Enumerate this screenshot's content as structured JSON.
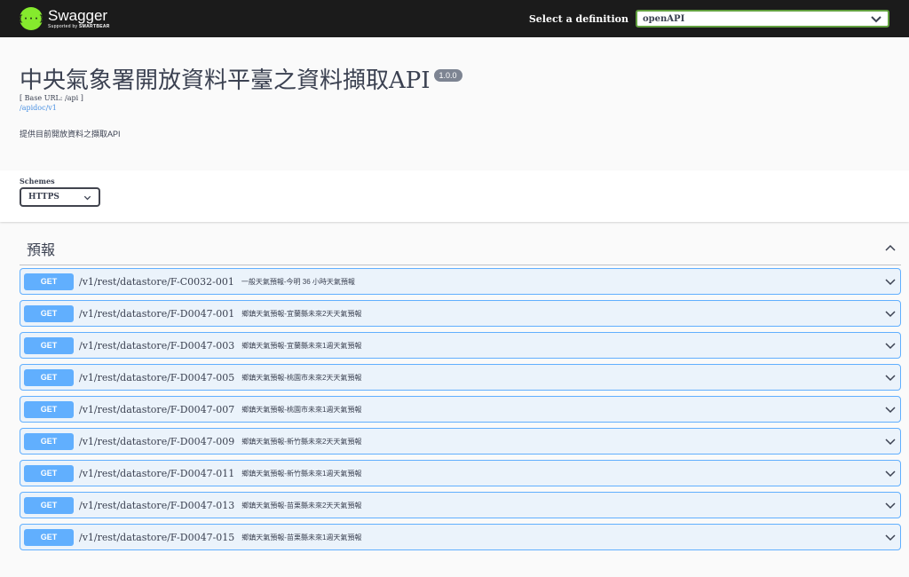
{
  "topbar": {
    "logo_mark": "{···}",
    "logo_name": "Swagger",
    "logo_sub_prefix": "Supported by ",
    "logo_sub_brand": "SMARTBEAR",
    "definition_label": "Select a definition",
    "definition_value": "openAPI"
  },
  "info": {
    "title": "中央氣象署開放資料平臺之資料擷取API",
    "version": "1.0.0",
    "base_url": "[ Base URL: /api ]",
    "link": "/apidoc/v1",
    "description": "提供目前開放資料之擷取API"
  },
  "schemes": {
    "label": "Schemes",
    "value": "HTTPS"
  },
  "section": {
    "tag": "預報",
    "operations": [
      {
        "method": "GET",
        "path": "/v1/rest/datastore/F-C0032-001",
        "summary": "一般天氣預報-今明 36 小時天氣預報"
      },
      {
        "method": "GET",
        "path": "/v1/rest/datastore/F-D0047-001",
        "summary": "鄉鎮天氣預報-宜蘭縣未來2天天氣預報"
      },
      {
        "method": "GET",
        "path": "/v1/rest/datastore/F-D0047-003",
        "summary": "鄉鎮天氣預報-宜蘭縣未來1週天氣預報"
      },
      {
        "method": "GET",
        "path": "/v1/rest/datastore/F-D0047-005",
        "summary": "鄉鎮天氣預報-桃園市未來2天天氣預報"
      },
      {
        "method": "GET",
        "path": "/v1/rest/datastore/F-D0047-007",
        "summary": "鄉鎮天氣預報-桃園市未來1週天氣預報"
      },
      {
        "method": "GET",
        "path": "/v1/rest/datastore/F-D0047-009",
        "summary": "鄉鎮天氣預報-新竹縣未來2天天氣預報"
      },
      {
        "method": "GET",
        "path": "/v1/rest/datastore/F-D0047-011",
        "summary": "鄉鎮天氣預報-新竹縣未來1週天氣預報"
      },
      {
        "method": "GET",
        "path": "/v1/rest/datastore/F-D0047-013",
        "summary": "鄉鎮天氣預報-苗栗縣未來2天天氣預報"
      },
      {
        "method": "GET",
        "path": "/v1/rest/datastore/F-D0047-015",
        "summary": "鄉鎮天氣預報-苗栗縣未來1週天氣預報"
      }
    ]
  },
  "colors": {
    "topbar_bg": "#1b1b1b",
    "logo_green": "#85ea2d",
    "get_blue": "#61affe",
    "get_bg": "#ebf3fb"
  }
}
